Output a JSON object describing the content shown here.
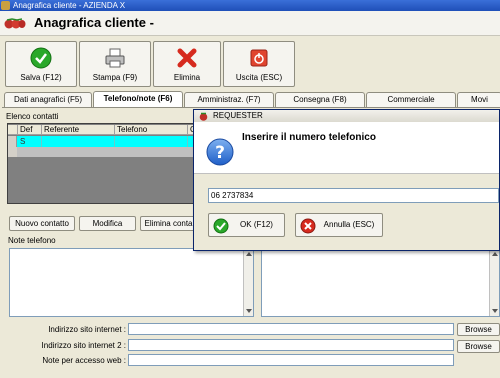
{
  "window": {
    "title": "Anagrafica cliente - AZIENDA X"
  },
  "header": {
    "title": "Anagrafica cliente -"
  },
  "toolbar": {
    "save": "Salva (F12)",
    "print": "Stampa (F9)",
    "delete": "Elimina",
    "exit": "Uscita (ESC)"
  },
  "tabs": [
    {
      "label": "Dati anagrafici (F5)"
    },
    {
      "label": "Telefono/note (F6)"
    },
    {
      "label": "Amministraz. (F7)"
    },
    {
      "label": "Consegna (F8)"
    },
    {
      "label": "Commerciale"
    },
    {
      "label": "Movi"
    }
  ],
  "contacts": {
    "label": "Elenco contatti",
    "columns": [
      "Def",
      "Referente",
      "Telefono",
      "C"
    ],
    "rows": [
      {
        "def": "S",
        "referente": "",
        "telefono": "",
        "c": ""
      }
    ]
  },
  "contact_buttons": {
    "new": "Nuovo contatto",
    "edit": "Modifica",
    "delete": "Elimina conta"
  },
  "notes": {
    "label": "Note telefono"
  },
  "fields": {
    "site1_label": "Indirizzo sito internet :",
    "site2_label": "Indirizzo sito internet 2 :",
    "web_notes_label": "Note per accesso web :",
    "site1_value": "",
    "site2_value": "",
    "web_notes_value": "",
    "browse": "Browse"
  },
  "dialog": {
    "title": "REQUESTER",
    "message": "Inserire il numero telefonico",
    "input_value": "06 2737834",
    "ok": "OK (F12)",
    "cancel": "Annulla (ESC)"
  },
  "colors": {
    "title_bar": "#1f4fb8",
    "grid_selection": "#00ffff",
    "ok_green": "#22aa22",
    "cancel_red": "#cc2222"
  }
}
